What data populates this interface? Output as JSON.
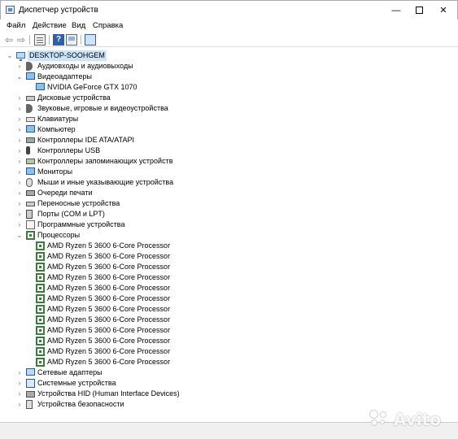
{
  "window": {
    "title": "Диспетчер устройств",
    "minimize_glyph": "—",
    "close_glyph": "✕"
  },
  "menu": [
    "Файл",
    "Действие",
    "Вид",
    "Справка"
  ],
  "toolbar": {
    "back_glyph": "⇦",
    "forward_glyph": "⇨",
    "help_glyph": "?"
  },
  "tree": {
    "root": "DESKTOP-SOOHGEM",
    "expanded_glyph": "⌄",
    "collapsed_glyph": "›",
    "categories": [
      {
        "label": "Аудиовходы и аудиовыходы",
        "icon": "audio-icon",
        "expanded": false
      },
      {
        "label": "Видеоадаптеры",
        "icon": "display-adapter-icon",
        "expanded": true,
        "children": [
          "NVIDIA GeForce GTX 1070"
        ]
      },
      {
        "label": "Дисковые устройства",
        "icon": "disk-drive-icon",
        "expanded": false
      },
      {
        "label": "Звуковые, игровые и видеоустройства",
        "icon": "sound-icon",
        "expanded": false
      },
      {
        "label": "Клавиатуры",
        "icon": "keyboard-icon",
        "expanded": false
      },
      {
        "label": "Компьютер",
        "icon": "computer-icon",
        "expanded": false
      },
      {
        "label": "Контроллеры IDE ATA/ATAPI",
        "icon": "ide-controller-icon",
        "expanded": false
      },
      {
        "label": "Контроллеры USB",
        "icon": "usb-icon",
        "expanded": false
      },
      {
        "label": "Контроллеры запоминающих устройств",
        "icon": "storage-controller-icon",
        "expanded": false
      },
      {
        "label": "Мониторы",
        "icon": "monitor-icon",
        "expanded": false
      },
      {
        "label": "Мыши и иные указывающие устройства",
        "icon": "mouse-icon",
        "expanded": false
      },
      {
        "label": "Очереди печати",
        "icon": "print-queue-icon",
        "expanded": false
      },
      {
        "label": "Переносные устройства",
        "icon": "portable-device-icon",
        "expanded": false
      },
      {
        "label": "Порты (COM и LPT)",
        "icon": "port-icon",
        "expanded": false
      },
      {
        "label": "Программные устройства",
        "icon": "software-device-icon",
        "expanded": false
      },
      {
        "label": "Процессоры",
        "icon": "processor-icon",
        "expanded": true,
        "children": [
          "AMD Ryzen 5 3600 6-Core Processor",
          "AMD Ryzen 5 3600 6-Core Processor",
          "AMD Ryzen 5 3600 6-Core Processor",
          "AMD Ryzen 5 3600 6-Core Processor",
          "AMD Ryzen 5 3600 6-Core Processor",
          "AMD Ryzen 5 3600 6-Core Processor",
          "AMD Ryzen 5 3600 6-Core Processor",
          "AMD Ryzen 5 3600 6-Core Processor",
          "AMD Ryzen 5 3600 6-Core Processor",
          "AMD Ryzen 5 3600 6-Core Processor",
          "AMD Ryzen 5 3600 6-Core Processor",
          "AMD Ryzen 5 3600 6-Core Processor"
        ]
      },
      {
        "label": "Сетевые адаптеры",
        "icon": "network-adapter-icon",
        "expanded": false
      },
      {
        "label": "Системные устройства",
        "icon": "system-device-icon",
        "expanded": false
      },
      {
        "label": "Устройства HID (Human Interface Devices)",
        "icon": "hid-icon",
        "expanded": false
      },
      {
        "label": "Устройства безопасности",
        "icon": "security-device-icon",
        "expanded": false
      }
    ]
  },
  "watermark": "Avito"
}
